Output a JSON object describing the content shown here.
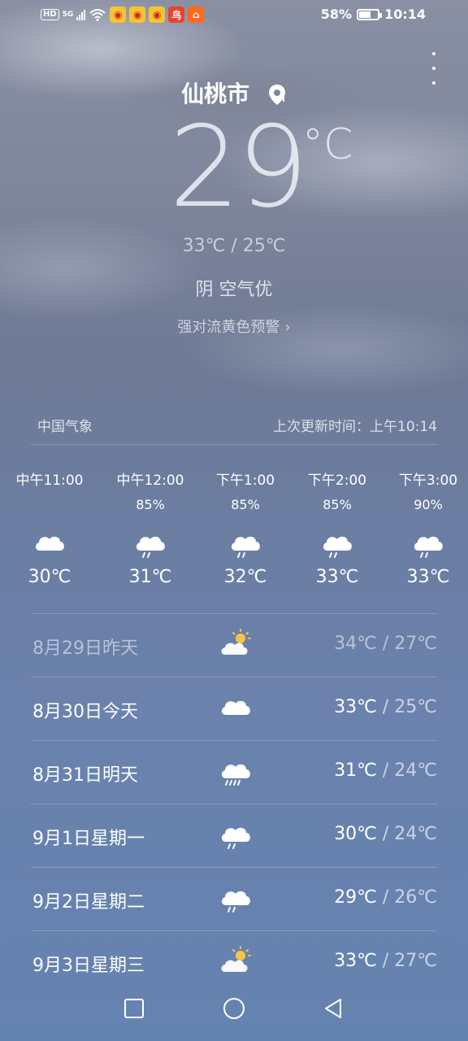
{
  "status_bar": {
    "hd": "HD",
    "network": "5G",
    "battery": "58%",
    "battery_level": 0.58,
    "time": "10:14"
  },
  "header": {
    "city": "仙桃市"
  },
  "current": {
    "temperature": "29",
    "unit": "°C",
    "range": "33℃ / 25℃",
    "condition": "阴  空气优",
    "alert": "强对流黄色预警"
  },
  "meta": {
    "source": "中国气象",
    "updated": "上次更新时间：上午10:14"
  },
  "hourly": [
    {
      "time": "中午11:00",
      "precip": "",
      "icon": "cloudy-icon",
      "temp": "30℃"
    },
    {
      "time": "中午12:00",
      "precip": "85%",
      "icon": "light-rain-icon",
      "temp": "31℃"
    },
    {
      "time": "下午1:00",
      "precip": "85%",
      "icon": "light-rain-icon",
      "temp": "32℃"
    },
    {
      "time": "下午2:00",
      "precip": "85%",
      "icon": "light-rain-icon",
      "temp": "33℃"
    },
    {
      "time": "下午3:00",
      "precip": "90%",
      "icon": "light-rain-icon",
      "temp": "33℃"
    }
  ],
  "daily": [
    {
      "date": "8月29日昨天",
      "icon": "partly-cloudy-icon",
      "high": "34℃",
      "low": "27℃"
    },
    {
      "date": "8月30日今天",
      "icon": "cloudy-icon",
      "high": "33℃",
      "low": "25℃"
    },
    {
      "date": "8月31日明天",
      "icon": "heavy-rain-icon",
      "high": "31℃",
      "low": "24℃"
    },
    {
      "date": "9月1日星期一",
      "icon": "light-rain-icon",
      "high": "30℃",
      "low": "24℃"
    },
    {
      "date": "9月2日星期二",
      "icon": "light-rain-icon",
      "high": "29℃",
      "low": "26℃"
    },
    {
      "date": "9月3日星期三",
      "icon": "partly-cloudy-icon",
      "high": "33℃",
      "low": "27℃"
    }
  ],
  "colors": {
    "sun": "#f5c542",
    "cloud": "#ffffff",
    "rain": "#ffffff"
  }
}
